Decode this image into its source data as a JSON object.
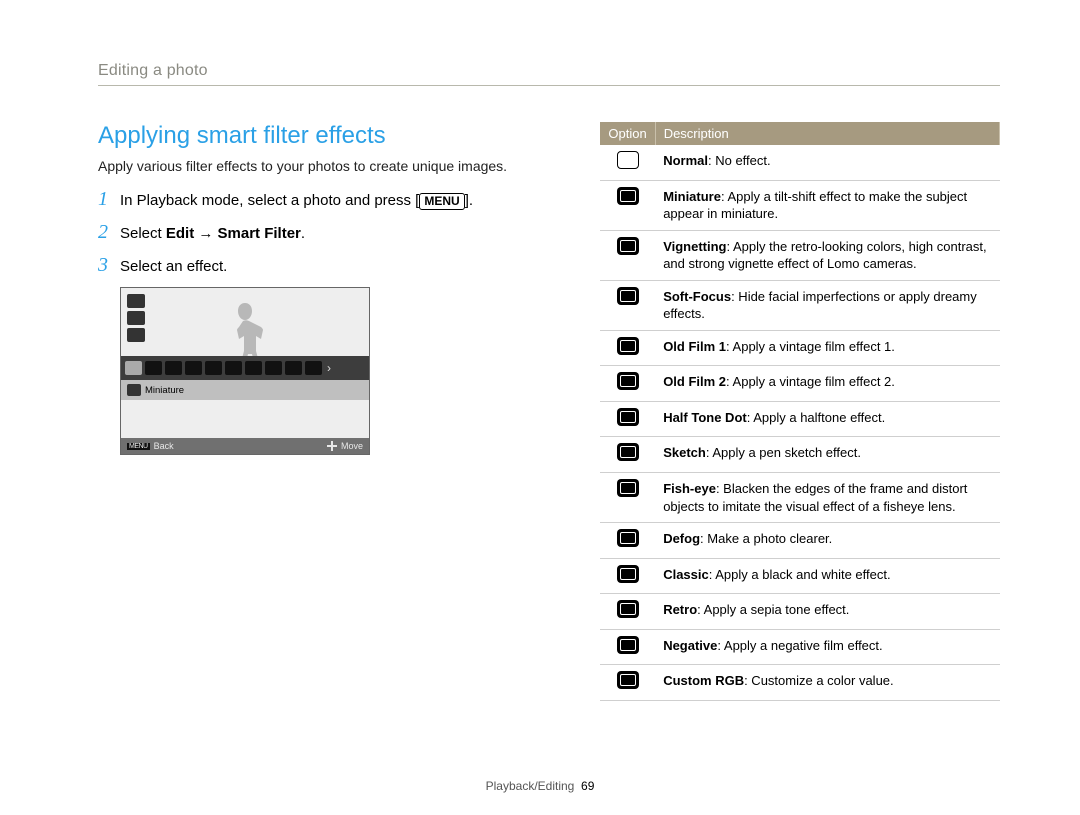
{
  "breadcrumb": "Editing a photo",
  "section_title": "Applying smart filter effects",
  "intro": "Apply various filter effects to your photos to create unique images.",
  "steps": [
    {
      "num": "1",
      "pre": "In Playback mode, select a photo and press [",
      "chip": "MENU",
      "post": "]."
    },
    {
      "num": "2",
      "pre": "Select ",
      "bold": "Edit → Smart Filter",
      "post": "."
    },
    {
      "num": "3",
      "pre": "Select an effect.",
      "bold": "",
      "post": ""
    }
  ],
  "cam": {
    "selected_filter": "Miniature",
    "footer_back_label": "Back",
    "footer_back_chip": "MENU",
    "footer_move_label": "Move"
  },
  "table": {
    "head_option": "Option",
    "head_desc": "Description",
    "rows": [
      {
        "label": "Normal",
        "desc": ": No effect."
      },
      {
        "label": "Miniature",
        "desc": ": Apply a tilt-shift effect to make the subject appear in miniature."
      },
      {
        "label": "Vignetting",
        "desc": ": Apply the retro-looking colors, high contrast, and strong vignette effect of Lomo cameras."
      },
      {
        "label": "Soft-Focus",
        "desc": ": Hide facial imperfections or apply dreamy effects."
      },
      {
        "label": "Old Film 1",
        "desc": ": Apply a vintage film effect 1."
      },
      {
        "label": "Old Film 2",
        "desc": ": Apply a vintage film effect 2."
      },
      {
        "label": "Half Tone Dot",
        "desc": ": Apply a halftone effect."
      },
      {
        "label": "Sketch",
        "desc": ": Apply a pen sketch effect."
      },
      {
        "label": "Fish-eye",
        "desc": ": Blacken the edges of the frame and distort objects to imitate the visual effect of a fisheye lens."
      },
      {
        "label": "Defog",
        "desc": ": Make a photo clearer."
      },
      {
        "label": "Classic",
        "desc": ": Apply a black and white effect."
      },
      {
        "label": "Retro",
        "desc": ": Apply a sepia tone effect."
      },
      {
        "label": "Negative",
        "desc": ": Apply a negative film effect."
      },
      {
        "label": "Custom RGB",
        "desc": ": Customize a color value."
      }
    ]
  },
  "footer": {
    "section": "Playback/Editing",
    "page": "69"
  }
}
